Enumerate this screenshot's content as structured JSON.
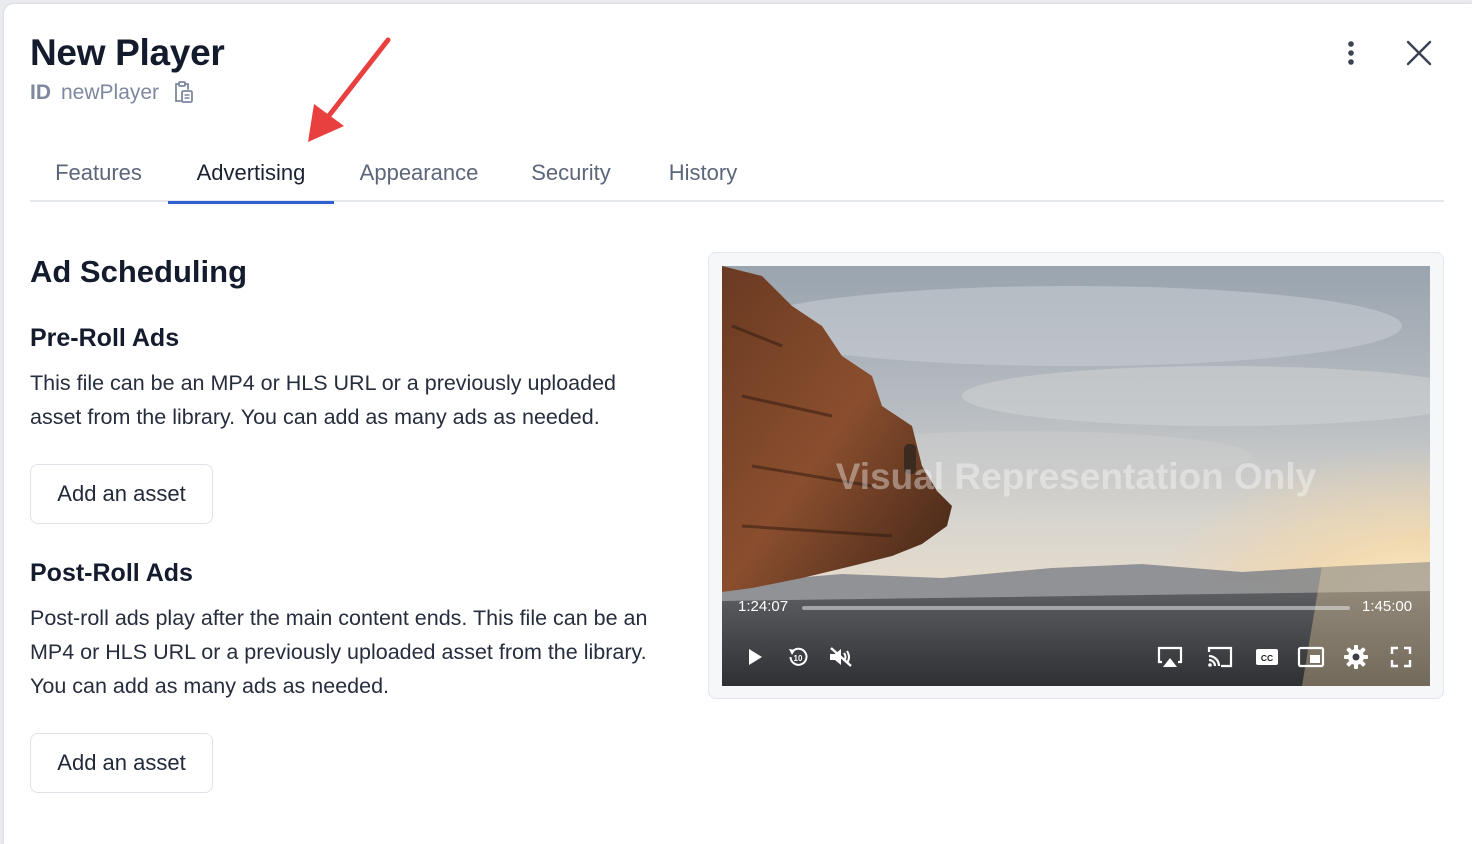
{
  "header": {
    "title": "New Player",
    "id_label": "ID",
    "id_value": "newPlayer"
  },
  "tabs": [
    {
      "label": "Features",
      "active": false
    },
    {
      "label": "Advertising",
      "active": true
    },
    {
      "label": "Appearance",
      "active": false
    },
    {
      "label": "Security",
      "active": false
    },
    {
      "label": "History",
      "active": false
    }
  ],
  "content": {
    "section_title": "Ad Scheduling",
    "preroll": {
      "title": "Pre-Roll Ads",
      "description": "This file can be an MP4 or HLS URL or a previously uploaded asset from the library. You can add as many ads as needed.",
      "button_label": "Add an asset"
    },
    "postroll": {
      "title": "Post-Roll Ads",
      "description": "Post-roll ads play after the main content ends. This file can be an MP4 or HLS URL or a previously uploaded asset from the library. You can add as many ads as needed.",
      "button_label": "Add an asset"
    }
  },
  "preview": {
    "watermark": "Visual Representation Only",
    "current_time": "1:24:07",
    "duration": "1:45:00",
    "progress": 0.0
  },
  "icons": {
    "copy": "copy-icon",
    "more": "more-vertical-icon",
    "close": "close-icon",
    "play": "play-icon",
    "rewind": "rewind-10-icon",
    "mute": "volume-muted-icon",
    "airplay": "airplay-icon",
    "cast": "cast-icon",
    "captions": "closed-captions-icon",
    "pip": "picture-in-picture-icon",
    "settings": "settings-gear-icon",
    "fullscreen": "fullscreen-icon"
  },
  "colors": {
    "accent": "#2f5fd0",
    "annotation_arrow": "#e8403f"
  }
}
